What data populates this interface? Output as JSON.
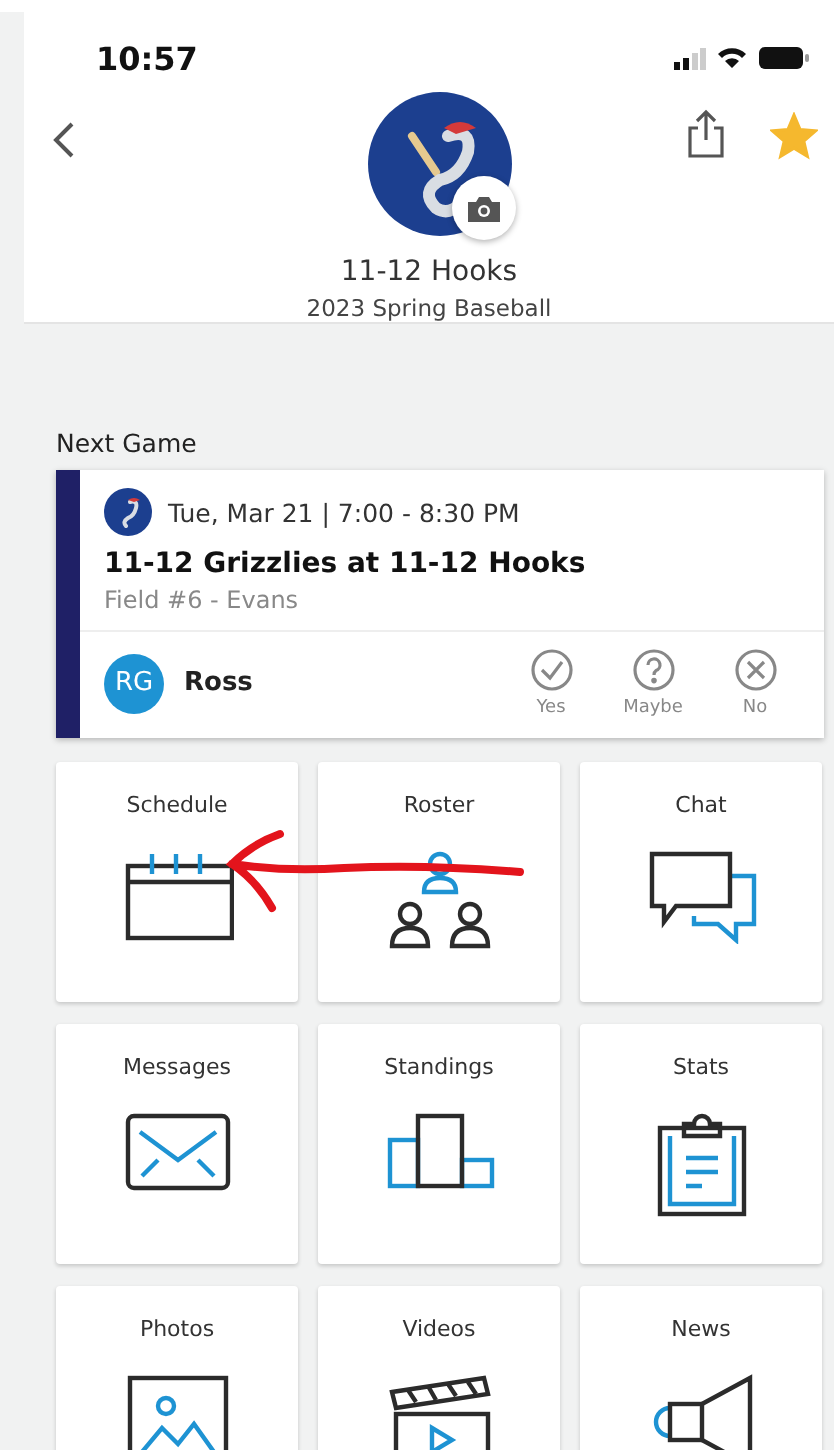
{
  "status_bar": {
    "time": "10:57"
  },
  "team": {
    "name": "11-12 Hooks",
    "season": "2023 Spring Baseball",
    "favorite": true
  },
  "next_game": {
    "heading": "Next Game",
    "datetime": "Tue, Mar 21 | 7:00 - 8:30 PM",
    "title": "11-12 Grizzlies at 11-12 Hooks",
    "location": "Field #6 - Evans",
    "player": {
      "initials": "RG",
      "name": "Ross"
    },
    "rsvp": [
      {
        "kind": "yes",
        "label": "Yes",
        "selected": false
      },
      {
        "kind": "maybe",
        "label": "Maybe",
        "selected": false
      },
      {
        "kind": "no",
        "label": "No",
        "selected": false
      }
    ]
  },
  "tiles": [
    {
      "label": "Schedule",
      "kind": "calendar"
    },
    {
      "label": "Roster",
      "kind": "people"
    },
    {
      "label": "Chat",
      "kind": "chat"
    },
    {
      "label": "Messages",
      "kind": "envelope"
    },
    {
      "label": "Standings",
      "kind": "podium"
    },
    {
      "label": "Stats",
      "kind": "clipboard"
    },
    {
      "label": "Photos",
      "kind": "picture"
    },
    {
      "label": "Videos",
      "kind": "clapper"
    },
    {
      "label": "News",
      "kind": "megaphone"
    }
  ]
}
